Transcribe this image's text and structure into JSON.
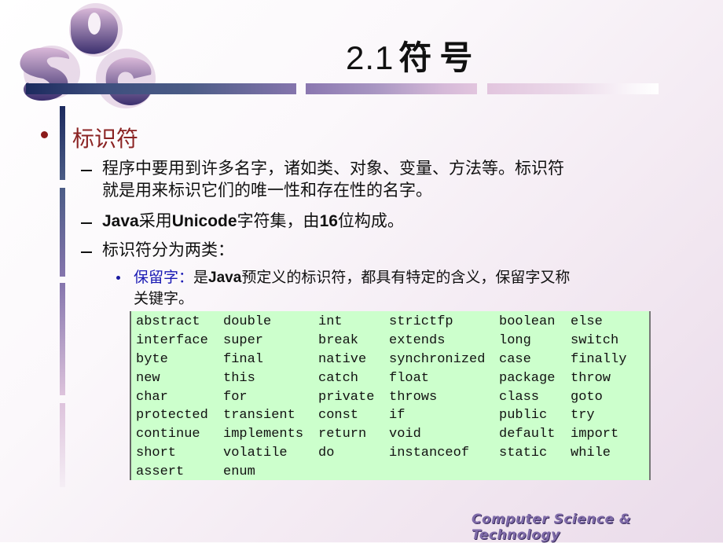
{
  "slide": {
    "title_number": "2.1",
    "title_text": "符号",
    "logo_letters": [
      "S",
      "U",
      "C"
    ],
    "footer": "Computer Science  & Technology",
    "heading": "标识符",
    "points": [
      {
        "line1": "程序中要用到许多名字，诸如类、对象、变量、方法等。标识符",
        "line2": "就是用来标识它们的唯一性和存在性的名字。"
      },
      {
        "p1": "Java",
        "p2": "采用",
        "p3": "Unicode",
        "p4": "字符集，由",
        "p5": "16",
        "p6": "位构成。"
      },
      {
        "text": "标识符分为两类："
      }
    ],
    "sub_point": {
      "label": "保留字：",
      "t1": "是",
      "t2": "Java",
      "t3": "预定义的标识符，都具有特定的含义，保留字又称",
      "line2": "关键字。"
    },
    "keywords": [
      [
        "abstract",
        "double",
        "int",
        "strictfp",
        "boolean",
        "else"
      ],
      [
        "interface",
        "super",
        "break",
        "extends",
        "long",
        "switch"
      ],
      [
        "byte",
        "final",
        "native",
        "synchronized",
        "case",
        "finally"
      ],
      [
        "new",
        "this",
        "catch",
        "float",
        "package",
        "throw"
      ],
      [
        "char",
        "for",
        "private",
        "throws",
        "class",
        "goto"
      ],
      [
        "protected",
        "transient",
        "const",
        "if",
        "public",
        "try"
      ],
      [
        "continue",
        "implements",
        "return",
        "void",
        "default",
        "import"
      ],
      [
        "short",
        "volatile",
        "do",
        "instanceof",
        "static",
        "while"
      ],
      [
        "assert",
        "enum",
        "",
        "",
        "",
        ""
      ]
    ],
    "colors": {
      "heading": "#8b2323",
      "sub_label": "#1a1ab4",
      "table_bg": "#ccffcc",
      "footer": "#7e6aa8"
    }
  }
}
